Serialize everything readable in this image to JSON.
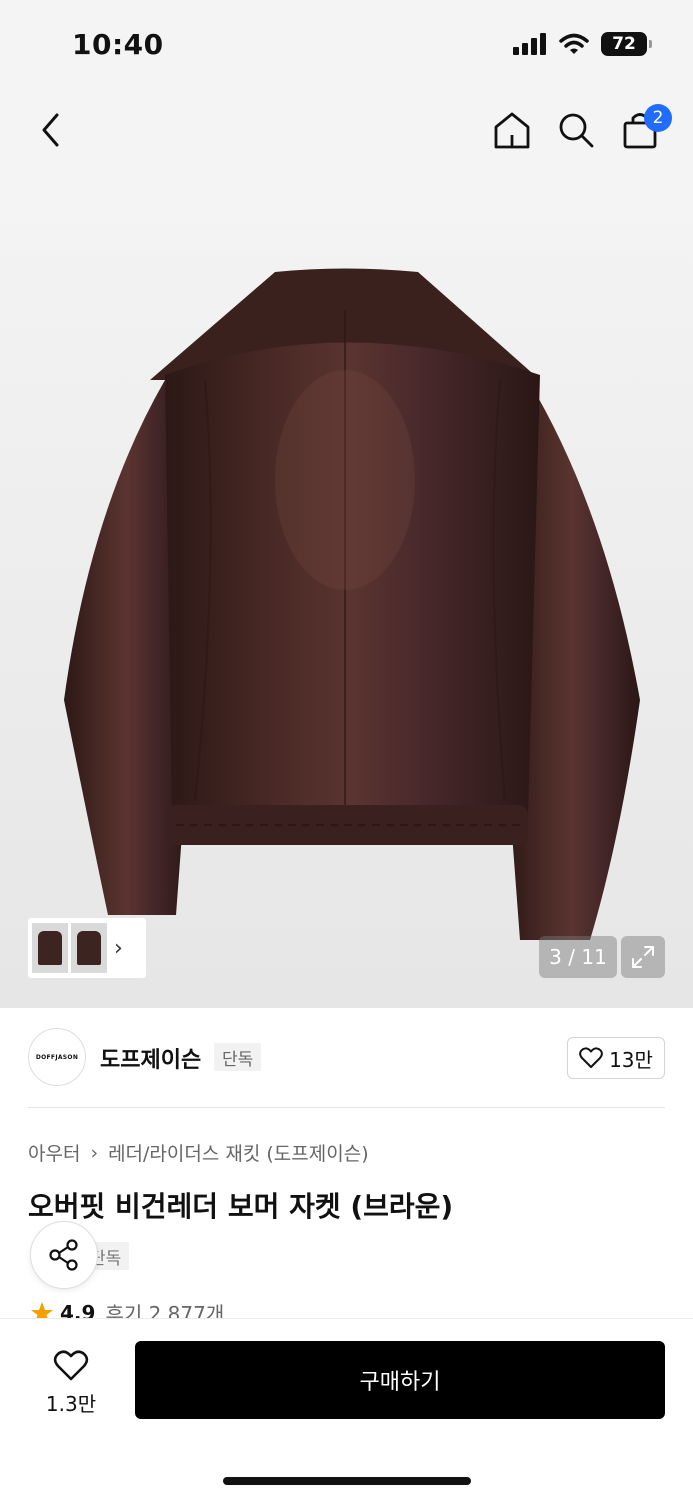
{
  "status_bar": {
    "time": "10:40",
    "battery": "72"
  },
  "nav": {
    "cart_count": "2"
  },
  "gallery": {
    "page_counter": "3 / 11"
  },
  "brand": {
    "logo_text": "DOFFJASON",
    "name": "도프제이슨",
    "tag": "단독",
    "like_count": "13만"
  },
  "product": {
    "breadcrumb": [
      "아우터",
      "레더/라이더스 재킷 (도프제이슨)"
    ],
    "title": "오버핏 비건레더 보머 자켓 (브라운)",
    "tag": "단독",
    "rating": "4.9",
    "reviews": "후기 2,877개"
  },
  "bottom_bar": {
    "wish_count": "1.3만",
    "buy_label": "구매하기"
  },
  "colors": {
    "accent": "#1f6cff",
    "jacket": "#3f2420",
    "star": "#f5a000"
  }
}
